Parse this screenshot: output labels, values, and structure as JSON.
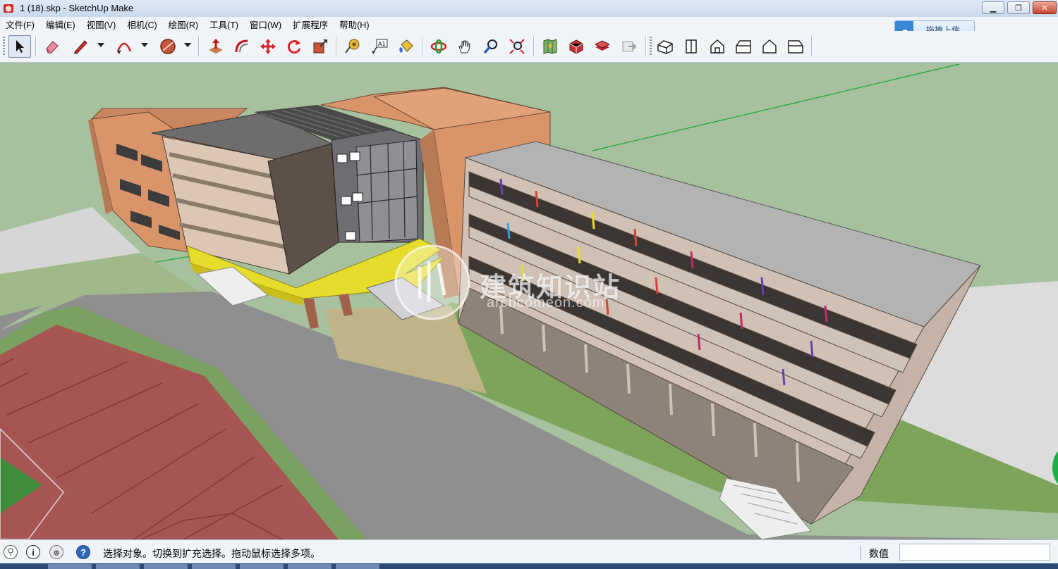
{
  "window": {
    "title": "1 (18).skp - SketchUp Make",
    "minimize_icon": "minimize-icon",
    "restore_icon": "restore-icon",
    "close_icon": "close-icon"
  },
  "menu": {
    "items": [
      "文件(F)",
      "编辑(E)",
      "视图(V)",
      "相机(C)",
      "绘图(R)",
      "工具(T)",
      "窗口(W)",
      "扩展程序",
      "帮助(H)"
    ]
  },
  "upload_button": {
    "label": "拖拽上传",
    "icon": "cloud-upload-icon"
  },
  "toolbar": {
    "tools": [
      "select",
      "eraser",
      "pencil-line",
      "arc",
      "shapes",
      "push-pull",
      "offset",
      "move",
      "rotate",
      "scale",
      "tape-measure",
      "text",
      "paint-bucket",
      "orbit",
      "pan",
      "zoom",
      "zoom-extents",
      "3d-warehouse",
      "extension-warehouse",
      "layout",
      "send-to-layout",
      "iso-view",
      "top-view",
      "front-view",
      "right-view",
      "back-view",
      "left-view"
    ],
    "active_tool": "select"
  },
  "viewport": {
    "watermark": "建筑知识站",
    "watermark_sub": "archcomeon.com"
  },
  "status": {
    "message": "选择对象。切换到扩充选择。拖动鼠标选择多项。",
    "measurements_label": "数值",
    "measurements_value": ""
  },
  "colors": {
    "sky_ground": "#a7c19e",
    "road": "#8f8f8f",
    "track": "#a75552",
    "facade_orange": "#d9946a",
    "roof_grey": "#b3b3b3",
    "canopy_yellow": "#e5dc2b"
  }
}
